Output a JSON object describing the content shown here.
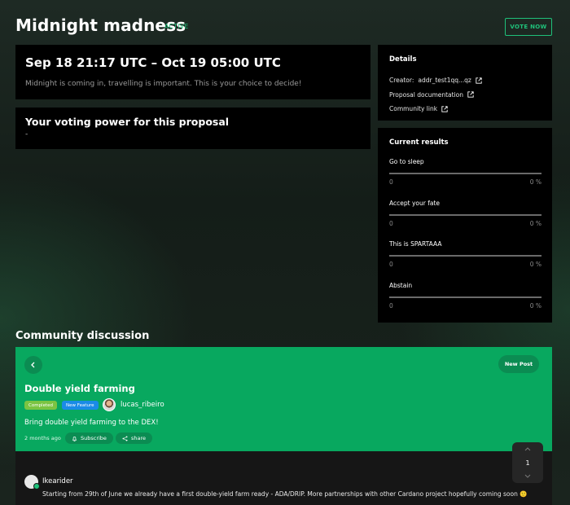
{
  "header": {
    "title": "Midnight madness",
    "status": "ACTIVE",
    "vote_button": "VOTE NOW"
  },
  "proposal": {
    "date_range": "Sep 18 21:17 UTC – Oct 19 05:00 UTC",
    "description": "Midnight is coming in, travelling is important. This is your choice to decide!"
  },
  "voting_power": {
    "title": "Your voting power for this proposal",
    "value": "-"
  },
  "details": {
    "heading": "Details",
    "creator_label": "Creator:",
    "creator_value": "addr_test1qq...qz",
    "documentation_link": "Proposal documentation",
    "community_link": "Community link"
  },
  "results": {
    "heading": "Current results",
    "options": [
      {
        "name": "Go to sleep",
        "votes": "0",
        "percent": "0 %",
        "fraction": 0
      },
      {
        "name": "Accept your fate",
        "votes": "0",
        "percent": "0 %",
        "fraction": 0
      },
      {
        "name": "This is SPARTAAA",
        "votes": "0",
        "percent": "0 %",
        "fraction": 0
      },
      {
        "name": "Abstain",
        "votes": "0",
        "percent": "0 %",
        "fraction": 0
      }
    ]
  },
  "community": {
    "title": "Community discussion",
    "new_post_button": "New Post",
    "post": {
      "title": "Double yield farming",
      "tags": [
        "Completed",
        "New Feature"
      ],
      "author": "lucas_ribeiro",
      "body": "Bring double yield farming to the DEX!",
      "time_ago": "2 months ago",
      "subscribe_label": "Subscribe",
      "share_label": "share"
    },
    "comment": {
      "user": "Ikearider",
      "text": "Starting from 29th of June we already have a first double-yield farm ready - ADA/DRIP. More partnerships with other Cardano project hopefully coming soon 🙂"
    },
    "pager": {
      "page": "1"
    }
  },
  "colors": {
    "accent": "#1fc17a",
    "card_green": "#08a85f",
    "tag_completed": "#7bc442",
    "tag_feature": "#1a8be6",
    "panel": "#000000"
  }
}
